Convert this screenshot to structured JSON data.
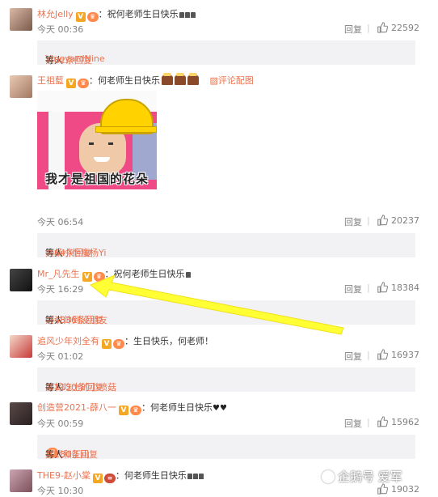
{
  "comments": [
    {
      "user": "林允Jelly",
      "text": "：祝何老师生日快乐",
      "time": "今天 00:36",
      "reply": "回复",
      "likes": "22592",
      "sub": {
        "name": "VineyardNine",
        "mid": "等人",
        "count": "共82条回复"
      }
    },
    {
      "user": "王祖藍",
      "text": "：何老师生日快乐",
      "pic_link": "评论配图",
      "time": "今天 06:54",
      "reply": "回复",
      "likes": "20237",
      "image_caption": "我才是祖国的花朵",
      "sub": {
        "name": "大杨小怡瘦杨Yi",
        "mid": "等人",
        "count": "共64条回复"
      }
    },
    {
      "user": "Mr_凡先生",
      "text": "：祝何老师生日快乐",
      "time": "今天 16:29",
      "reply": "回复",
      "likes": "18384",
      "sub": {
        "name": "听说帅到没朋友",
        "mid": "等人",
        "count": "共4836条回复"
      }
    },
    {
      "user": "追风少年刘全有",
      "text": "：生日快乐，何老师！",
      "time": "今天 01:02",
      "reply": "回复",
      "likes": "16937",
      "sub": {
        "name": "即将吃土的小喷菇",
        "mid": "等人",
        "count": "共1130条回复"
      }
    },
    {
      "user": "创造营2021-薛八一",
      "text": "：何老师生日快乐",
      "time": "今天 00:59",
      "reply": "回复",
      "likes": "15962",
      "sub": {
        "name": "美式和正山",
        "mid": "等人",
        "count": "共180条回复"
      }
    },
    {
      "user": "THE9-赵小棠",
      "text": "：何老师生日快乐",
      "time": "今天 10:30",
      "reply": "回复",
      "likes": "19032"
    }
  ],
  "watermark": "企鹅号 爱军",
  "colors": {
    "username": "#eb7350",
    "annotation_arrow": "#ffff33",
    "subbox": "#f2f2f5"
  }
}
